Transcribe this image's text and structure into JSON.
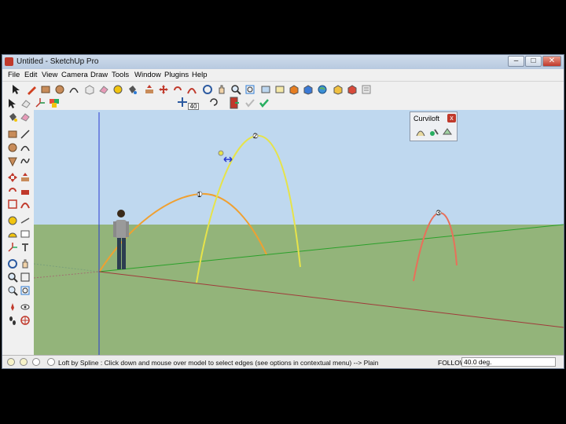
{
  "window": {
    "title": "Untitled - SketchUp Pro",
    "min_glyph": "–",
    "max_glyph": "□",
    "close_glyph": "✕"
  },
  "menu": [
    {
      "label": "File"
    },
    {
      "label": "Edit"
    },
    {
      "label": "View"
    },
    {
      "label": "Camera"
    },
    {
      "label": "Draw"
    },
    {
      "label": "Tools"
    },
    {
      "label": "Window"
    },
    {
      "label": "Plugins"
    },
    {
      "label": "Help"
    }
  ],
  "toolbar": {
    "follow_angle_value": "40"
  },
  "curviloft": {
    "title": "Curviloft",
    "close_glyph": "x"
  },
  "viewport": {
    "arc_labels": [
      "1",
      "2",
      "3"
    ],
    "colors": {
      "sky": "#bfd8ef",
      "ground": "#93b47a",
      "arc1": "#f0a030",
      "arc2": "#e6e34a",
      "arc3": "#e8705a",
      "green_axis": "#2aa02a",
      "red_axis": "#a03a3a",
      "blue_axis": "#2a3ad0"
    }
  },
  "status": {
    "message": "Loft by Spline : Click down and mouse over model to select edges (see options in contextual menu) --> Plain",
    "vcb_label": "FOLLOW",
    "vcb_value": "40.0 deg."
  }
}
